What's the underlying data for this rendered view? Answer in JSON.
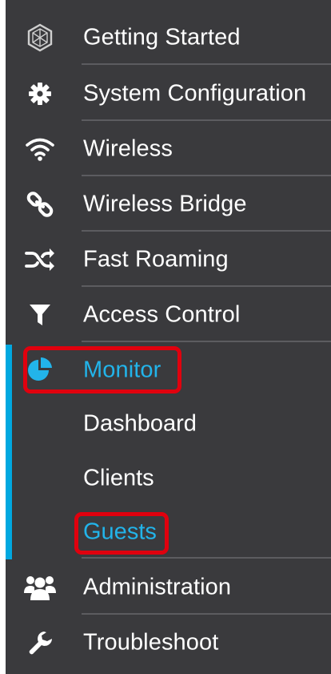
{
  "nav": {
    "items": [
      {
        "label": "Getting Started",
        "icon": "hexagon-logo-icon"
      },
      {
        "label": "System Configuration",
        "icon": "gear-icon"
      },
      {
        "label": "Wireless",
        "icon": "wifi-icon"
      },
      {
        "label": "Wireless Bridge",
        "icon": "link-icon"
      },
      {
        "label": "Fast Roaming",
        "icon": "shuffle-icon"
      },
      {
        "label": "Access Control",
        "icon": "filter-icon"
      },
      {
        "label": "Monitor",
        "icon": "pie-chart-icon",
        "active": true
      },
      {
        "label": "Administration",
        "icon": "users-icon"
      },
      {
        "label": "Troubleshoot",
        "icon": "wrench-icon"
      }
    ],
    "monitor_children": [
      {
        "label": "Dashboard"
      },
      {
        "label": "Clients"
      },
      {
        "label": "Guests",
        "selected": true
      }
    ]
  },
  "colors": {
    "sidebar_bg": "#3a3a3d",
    "accent": "#22b4ea",
    "active_bar": "#00a8e0",
    "highlight_box": "#e0000e",
    "text": "#ffffff"
  }
}
